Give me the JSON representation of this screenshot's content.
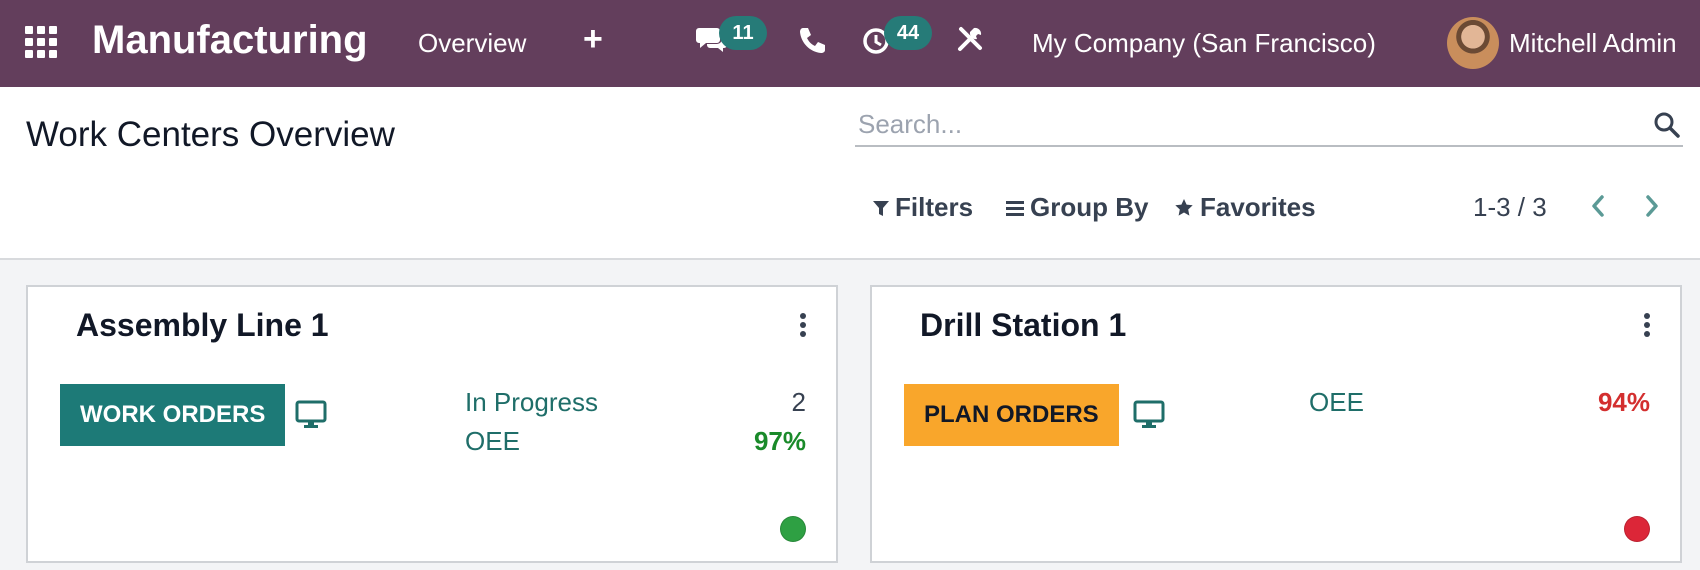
{
  "app": {
    "title": "Manufacturing"
  },
  "topbar": {
    "menu_overview": "Overview",
    "add_label": "+",
    "messages_count": "11",
    "activities_count": "44",
    "company": "My Company (San Francisco)",
    "user": "Mitchell Admin",
    "brand_color": "#633e5c",
    "badge_color": "#267b78"
  },
  "page": {
    "title": "Work Centers Overview"
  },
  "search": {
    "placeholder": "Search..."
  },
  "filters": {
    "filters_label": "Filters",
    "groupby_label": "Group By",
    "favorites_label": "Favorites"
  },
  "pager": {
    "value": "1-3 / 3"
  },
  "cards": [
    {
      "title": "Assembly Line 1",
      "button_label": "WORK ORDERS",
      "button_color": "#1d7a77",
      "stats": [
        {
          "label": "In Progress",
          "value": "2",
          "value_color": "#374151"
        },
        {
          "label": "OEE",
          "value": "97%",
          "value_color": "#1a8a2a"
        }
      ],
      "status_color": "#2ea043"
    },
    {
      "title": "Drill Station 1",
      "button_label": "PLAN ORDERS",
      "button_color": "#f9a62b",
      "stats": [
        {
          "label": "OEE",
          "value": "94%",
          "value_color": "#d32f2f"
        }
      ],
      "status_color": "#dc2638"
    }
  ],
  "icons": [
    "apps-grid-icon",
    "chat-icon",
    "phone-icon",
    "activity-clock-icon",
    "tools-icon",
    "search-icon",
    "filter-icon",
    "groupby-icon",
    "star-icon",
    "chevron-left-icon",
    "chevron-right-icon",
    "kebab-icon",
    "monitor-icon"
  ]
}
